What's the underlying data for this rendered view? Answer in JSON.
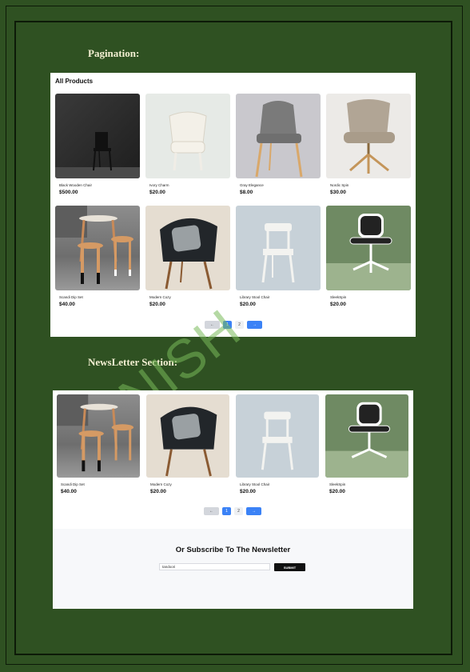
{
  "sections": {
    "pagination_title": "Pagination:",
    "newsletter_title": "NewsLetter Section:"
  },
  "watermark": "NISH",
  "all_products": {
    "heading": "All Products",
    "products": [
      {
        "name": "Black Wooden Chair",
        "price": "$500.00",
        "image": "chair-black-wooden-icon"
      },
      {
        "name": "Ivory Charm",
        "price": "$20.00",
        "image": "chair-ivory-icon"
      },
      {
        "name": "Gray Elegance",
        "price": "$8.00",
        "image": "chair-gray-icon"
      },
      {
        "name": "Nordic Spin",
        "price": "$30.00",
        "image": "chair-nordic-icon"
      },
      {
        "name": "Scandi Dip Set",
        "price": "$40.00",
        "image": "stool-set-icon"
      },
      {
        "name": "Modern Cozy",
        "price": "$20.00",
        "image": "chair-cozy-icon"
      },
      {
        "name": "Library Stool Chair",
        "price": "$20.00",
        "image": "chair-library-icon"
      },
      {
        "name": "SleekSpin",
        "price": "$20.00",
        "image": "chair-office-icon"
      }
    ],
    "pagination": {
      "prev": "←",
      "pages": [
        "1",
        "2"
      ],
      "active_page": "1",
      "next": "→"
    }
  },
  "newsletter_page": {
    "products": [
      {
        "name": "Scandi Dip Set",
        "price": "$40.00"
      },
      {
        "name": "Modern Cozy",
        "price": "$20.00"
      },
      {
        "name": "Library Stool Chair",
        "price": "$20.00"
      },
      {
        "name": "SleekSpin",
        "price": "$20.00"
      }
    ],
    "pagination": {
      "prev": "←",
      "pages": [
        "1",
        "2"
      ],
      "active_page": "1",
      "next": "→"
    },
    "newsletter": {
      "title": "Or Subscribe To The Newsletter",
      "input_value": "tandoori",
      "button_label": "SUBMIT"
    }
  },
  "colors": {
    "page_bg": "#2f5122",
    "accent": "#3b82f6",
    "title_text": "#f3efd2"
  }
}
